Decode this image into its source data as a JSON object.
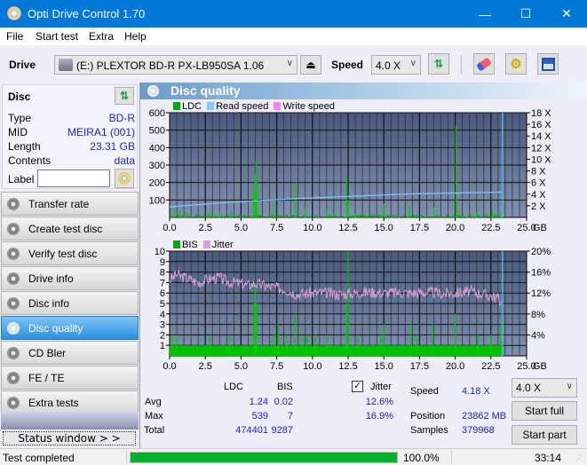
{
  "window": {
    "title": "Opti Drive Control 1.70",
    "minimize": "—",
    "maximize": "☐",
    "close": "✕"
  },
  "menu": [
    "File",
    "Start test",
    "Extra",
    "Help"
  ],
  "toolbar": {
    "drive_label": "Drive",
    "drive_value": "(E:)  PLEXTOR BD-R  PX-LB950SA 1.06",
    "speed_label": "Speed",
    "speed_value": "4.0 X"
  },
  "disc": {
    "header": "Disc",
    "rows": [
      {
        "key": "Type",
        "value": "BD-R"
      },
      {
        "key": "MID",
        "value": "MEIRA1 (001)"
      },
      {
        "key": "Length",
        "value": "23.31 GB"
      },
      {
        "key": "Contents",
        "value": "data"
      }
    ],
    "label_key": "Label",
    "label_value": ""
  },
  "nav": [
    {
      "label": "Transfer rate",
      "active": false
    },
    {
      "label": "Create test disc",
      "active": false
    },
    {
      "label": "Verify test disc",
      "active": false
    },
    {
      "label": "Drive info",
      "active": false
    },
    {
      "label": "Disc info",
      "active": false
    },
    {
      "label": "Disc quality",
      "active": true
    },
    {
      "label": "CD Bler",
      "active": false
    },
    {
      "label": "FE / TE",
      "active": false
    },
    {
      "label": "Extra tests",
      "active": false
    }
  ],
  "status_window_label": "Status window > >",
  "panel": {
    "title": "Disc quality"
  },
  "colors": {
    "ldc": "#00aa00",
    "read_speed": "#80c8ff",
    "write_speed": "#ff80ff",
    "bis": "#00aa00",
    "jitter": "#d8a0d8",
    "progress": "#06b025"
  },
  "chart_data": [
    {
      "type": "bar",
      "title": "LDC",
      "legend": [
        "LDC",
        "Read speed",
        "Write speed"
      ],
      "legend_position": "top-left",
      "x_ticks": [
        "0.0",
        "2.5",
        "5.0",
        "7.5",
        "10.0",
        "12.5",
        "15.0",
        "17.5",
        "20.0",
        "22.5",
        "25.0"
      ],
      "x_unit": "GB",
      "xlim": [
        0,
        25
      ],
      "ylim": [
        0,
        600
      ],
      "y_ticks": [
        "100",
        "200",
        "300",
        "400",
        "500",
        "600"
      ],
      "y2_ticks": [
        "2 X",
        "4 X",
        "6 X",
        "8 X",
        "10 X",
        "12 X",
        "14 X",
        "16 X",
        "18 X"
      ],
      "y2lim": [
        0,
        18
      ],
      "grid": true,
      "ldc_spikes": [
        [
          0.3,
          50
        ],
        [
          0.7,
          40
        ],
        [
          1.2,
          30
        ],
        [
          2.8,
          35
        ],
        [
          3.5,
          30
        ],
        [
          4.3,
          45
        ],
        [
          5.9,
          150
        ],
        [
          6.0,
          250
        ],
        [
          6.05,
          330
        ],
        [
          6.1,
          200
        ],
        [
          7.3,
          80
        ],
        [
          8.8,
          200
        ],
        [
          9.5,
          60
        ],
        [
          11.0,
          40
        ],
        [
          12.4,
          230
        ],
        [
          12.5,
          100
        ],
        [
          13.0,
          20
        ],
        [
          15.0,
          80
        ],
        [
          16.8,
          70
        ],
        [
          18.5,
          60
        ],
        [
          20.05,
          530
        ],
        [
          20.1,
          100
        ],
        [
          21.5,
          30
        ],
        [
          22.6,
          40
        ],
        [
          23.2,
          30
        ]
      ],
      "read_speed": [
        [
          0,
          1.8
        ],
        [
          1,
          2.0
        ],
        [
          2,
          2.2
        ],
        [
          3,
          2.4
        ],
        [
          4,
          2.55
        ],
        [
          5,
          2.7
        ],
        [
          6,
          2.85
        ],
        [
          7,
          3.0
        ],
        [
          8,
          3.1
        ],
        [
          9,
          3.25
        ],
        [
          10,
          3.35
        ],
        [
          11,
          3.45
        ],
        [
          12,
          3.55
        ],
        [
          13,
          3.65
        ],
        [
          14,
          3.75
        ],
        [
          15,
          3.85
        ],
        [
          16,
          3.95
        ],
        [
          17,
          4.05
        ],
        [
          18,
          4.1
        ],
        [
          19,
          4.15
        ],
        [
          20,
          4.2
        ],
        [
          21,
          4.25
        ],
        [
          22,
          4.3
        ],
        [
          23,
          4.35
        ],
        [
          23.31,
          4.4
        ]
      ],
      "end_marker": 23.31
    },
    {
      "type": "bar",
      "title": "BIS / Jitter",
      "legend": [
        "BIS",
        "Jitter"
      ],
      "legend_position": "top-left",
      "x_ticks": [
        "0.0",
        "2.5",
        "5.0",
        "7.5",
        "10.0",
        "12.5",
        "15.0",
        "17.5",
        "20.0",
        "22.5",
        "25.0"
      ],
      "x_unit": "GB",
      "xlim": [
        0,
        25
      ],
      "ylim": [
        0,
        10
      ],
      "y_ticks": [
        "1",
        "2",
        "3",
        "4",
        "5",
        "6",
        "7",
        "8",
        "9",
        "10"
      ],
      "y2_ticks": [
        "4%",
        "8%",
        "12%",
        "16%",
        "20%"
      ],
      "y2lim": [
        0,
        20
      ],
      "grid": true,
      "bis_baseline": 1,
      "bis_spikes": [
        [
          0.2,
          2
        ],
        [
          0.5,
          2
        ],
        [
          2.8,
          2
        ],
        [
          4.2,
          2
        ],
        [
          5.9,
          5
        ],
        [
          6.0,
          7
        ],
        [
          6.1,
          5
        ],
        [
          7.3,
          2
        ],
        [
          7.6,
          3
        ],
        [
          8.2,
          2
        ],
        [
          8.8,
          4
        ],
        [
          9.3,
          2
        ],
        [
          9.6,
          2
        ],
        [
          10.2,
          2
        ],
        [
          11.0,
          2
        ],
        [
          12.4,
          5
        ],
        [
          12.5,
          10
        ],
        [
          13.2,
          2
        ],
        [
          14.8,
          2
        ],
        [
          15.0,
          3
        ],
        [
          16.9,
          3
        ],
        [
          17.3,
          2
        ],
        [
          18.4,
          3
        ],
        [
          20.0,
          4
        ],
        [
          21.6,
          2
        ],
        [
          22.5,
          2
        ],
        [
          23.2,
          3
        ]
      ],
      "jitter": [
        [
          0,
          14.5
        ],
        [
          0.5,
          15.5
        ],
        [
          1,
          15
        ],
        [
          1.5,
          14.5
        ],
        [
          2,
          14
        ],
        [
          2.5,
          14.5
        ],
        [
          3,
          14.8
        ],
        [
          3.5,
          15
        ],
        [
          4,
          14.2
        ],
        [
          4.5,
          14
        ],
        [
          5,
          13.8
        ],
        [
          5.5,
          13.5
        ],
        [
          6,
          13.8
        ],
        [
          6.5,
          13.5
        ],
        [
          7,
          13.2
        ],
        [
          7.5,
          13
        ],
        [
          8,
          12.8
        ],
        [
          8.5,
          12.2
        ],
        [
          9,
          11.8
        ],
        [
          10,
          12
        ],
        [
          11,
          12
        ],
        [
          12,
          11.8
        ],
        [
          13,
          12
        ],
        [
          14,
          12.2
        ],
        [
          15,
          12
        ],
        [
          16,
          12.1
        ],
        [
          17,
          12
        ],
        [
          18,
          12.2
        ],
        [
          19,
          11.9
        ],
        [
          20,
          12
        ],
        [
          21,
          12.3
        ],
        [
          22,
          11.8
        ],
        [
          23,
          11
        ],
        [
          23.31,
          10
        ]
      ],
      "end_marker": 23.31
    }
  ],
  "stats": {
    "col_ldc": "LDC",
    "col_bis": "BIS",
    "jitter_label": "Jitter",
    "jitter_checked": true,
    "rows": [
      {
        "label": "Avg",
        "ldc": "1.24",
        "bis": "0.02",
        "jitter": "12.6%"
      },
      {
        "label": "Max",
        "ldc": "539",
        "bis": "7",
        "jitter": "16.9%"
      },
      {
        "label": "Total",
        "ldc": "474401",
        "bis": "9287",
        "jitter": ""
      }
    ],
    "speed_label": "Speed",
    "speed_value": "4.18 X",
    "position_label": "Position",
    "position_value": "23862 MB",
    "samples_label": "Samples",
    "samples_value": "379968",
    "speed_select": "4.0 X",
    "start_full": "Start full",
    "start_part": "Start part"
  },
  "statusbar": {
    "text": "Test completed",
    "progress": 100.0,
    "progress_text": "100.0%",
    "time": "33:14"
  }
}
